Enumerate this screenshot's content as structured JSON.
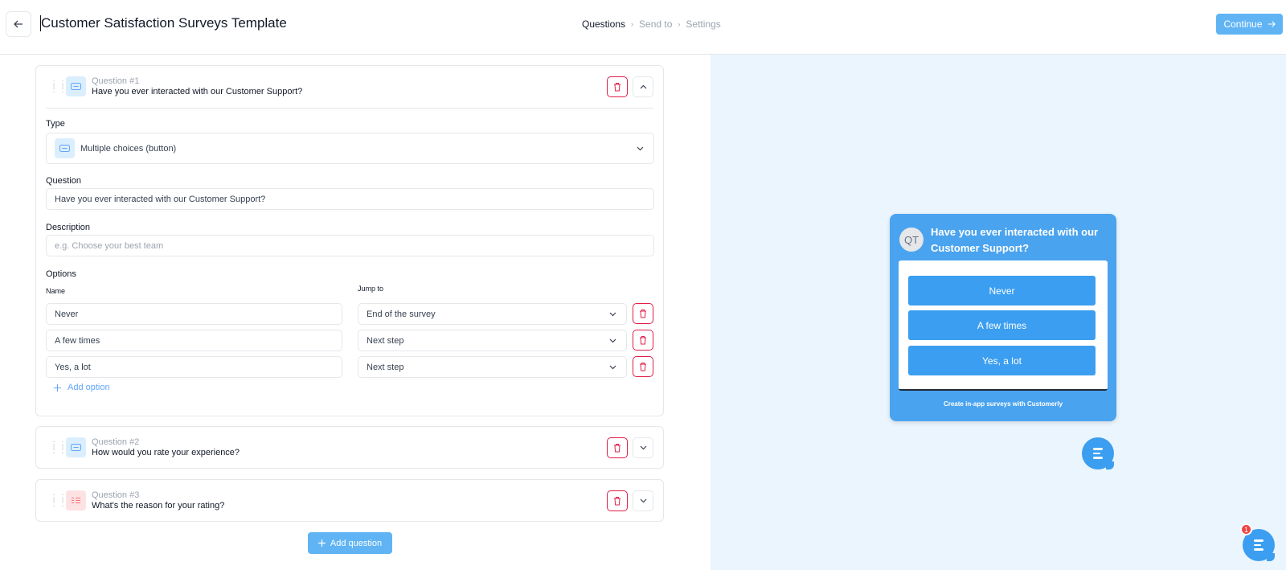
{
  "header": {
    "title": "Customer Satisfaction Surveys Template",
    "steps": [
      "Questions",
      "Send to",
      "Settings"
    ],
    "continue_label": "Continue"
  },
  "editor": {
    "questions": [
      {
        "number": "Question #1",
        "title": "Have you ever interacted with our Customer Support?",
        "icon": "button-choice-icon",
        "expanded": true
      },
      {
        "number": "Question #2",
        "title": "How would you rate your experience?",
        "icon": "button-choice-icon",
        "expanded": false
      },
      {
        "number": "Question #3",
        "title": "What's the reason for your rating?",
        "icon": "list-icon",
        "expanded": false
      }
    ],
    "type_label": "Type",
    "type_value": "Multiple choices (button)",
    "question_label": "Question",
    "question_value": "Have you ever interacted with our Customer Support?",
    "description_label": "Description",
    "description_placeholder": "e.g. Choose your best team",
    "options_label": "Options",
    "name_col": "Name",
    "jump_col": "Jump to",
    "options": [
      {
        "name": "Never",
        "jump": "End of the survey"
      },
      {
        "name": "A few times",
        "jump": "Next step"
      },
      {
        "name": "Yes, a lot",
        "jump": "Next step"
      }
    ],
    "add_option_label": "Add option",
    "add_question_label": "Add question"
  },
  "preview": {
    "avatar_initials": "QT",
    "question": "Have you ever interacted with our Customer Support?",
    "options": [
      "Never",
      "A few times",
      "Yes, a lot"
    ],
    "footer": "Create in-app surveys with Customerly",
    "badge_count": "1"
  },
  "colors": {
    "accent": "#60b4f4",
    "widget": "#4aa3ee",
    "danger": "#e11d48",
    "preview_bg": "#ebf5fd"
  }
}
